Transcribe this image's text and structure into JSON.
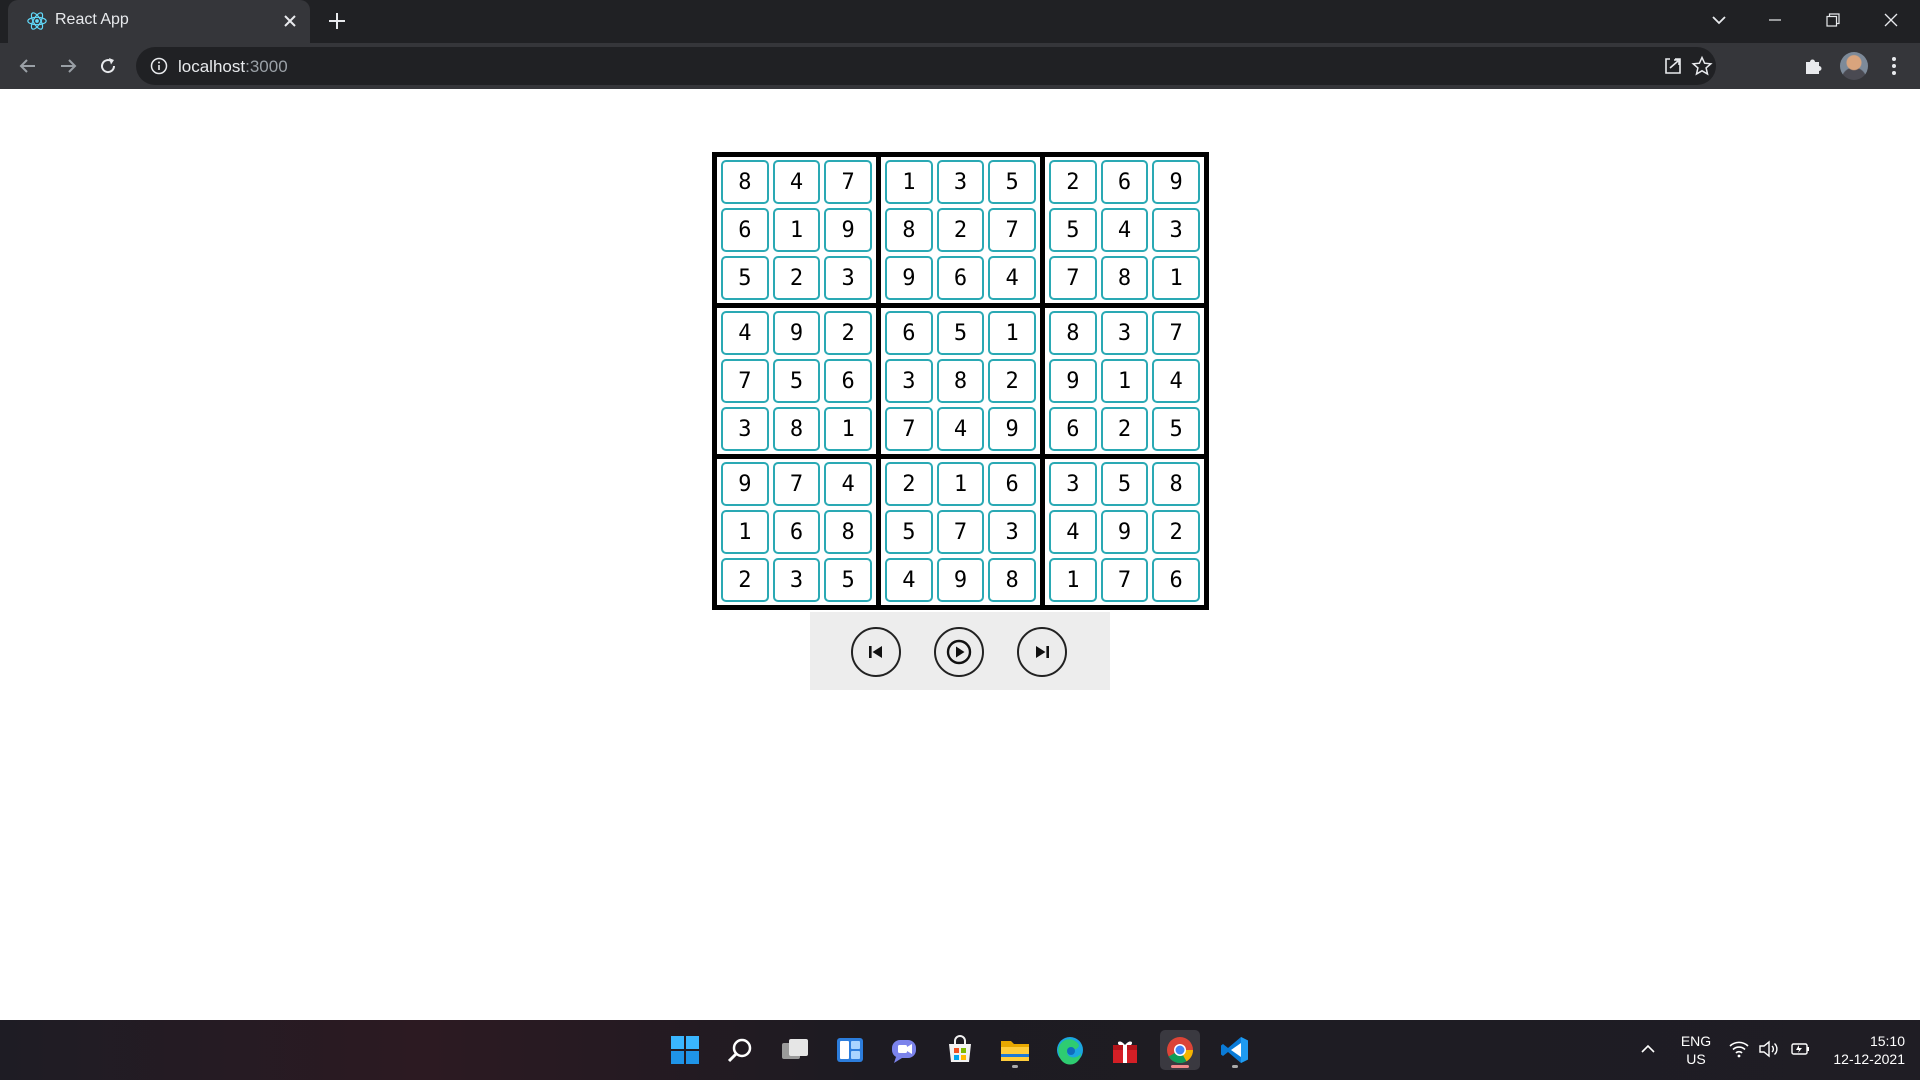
{
  "browser": {
    "tab_title": "React App",
    "url_host": "localhost",
    "url_port": ":3000"
  },
  "sudoku": {
    "boxes": [
      [
        "8",
        "4",
        "7",
        "6",
        "1",
        "9",
        "5",
        "2",
        "3"
      ],
      [
        "1",
        "3",
        "5",
        "8",
        "2",
        "7",
        "9",
        "6",
        "4"
      ],
      [
        "2",
        "6",
        "9",
        "5",
        "4",
        "3",
        "7",
        "8",
        "1"
      ],
      [
        "4",
        "9",
        "2",
        "7",
        "5",
        "6",
        "3",
        "8",
        "1"
      ],
      [
        "6",
        "5",
        "1",
        "3",
        "8",
        "2",
        "7",
        "4",
        "9"
      ],
      [
        "8",
        "3",
        "7",
        "9",
        "1",
        "4",
        "6",
        "2",
        "5"
      ],
      [
        "9",
        "7",
        "4",
        "1",
        "6",
        "8",
        "2",
        "3",
        "5"
      ],
      [
        "2",
        "1",
        "6",
        "5",
        "7",
        "3",
        "4",
        "9",
        "8"
      ],
      [
        "3",
        "5",
        "8",
        "4",
        "9",
        "2",
        "1",
        "7",
        "6"
      ]
    ],
    "cell_border_color": "#2aa9b4"
  },
  "controls": {
    "buttons": [
      "skip-previous-icon",
      "play-icon",
      "skip-next-icon"
    ]
  },
  "taskbar": {
    "apps": [
      "windows-start-icon",
      "search-icon",
      "task-view-icon",
      "widgets-icon",
      "teams-chat-icon",
      "microsoft-store-icon",
      "file-explorer-icon",
      "edge-icon",
      "gift-icon",
      "chrome-icon",
      "vscode-icon"
    ],
    "lang_line1": "ENG",
    "lang_line2": "US",
    "time": "15:10",
    "date": "12-12-2021"
  }
}
